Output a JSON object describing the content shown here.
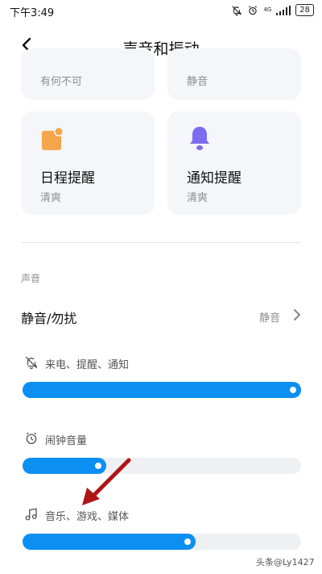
{
  "status_bar": {
    "time": "下午3:49",
    "network": "4G",
    "battery": "28"
  },
  "header": {
    "title": "声音和振动"
  },
  "cards": {
    "top_left_sub": "有何不可",
    "top_right_sub": "静音",
    "calendar_title": "日程提醒",
    "calendar_sub": "清爽",
    "notification_title": "通知提醒",
    "notification_sub": "清爽"
  },
  "sound_section": {
    "label": "声音",
    "dnd_label": "静音/勿扰",
    "dnd_value": "静音"
  },
  "volumes": [
    {
      "label": "来电、提醒、通知",
      "icon": "bell-off-icon",
      "level": 1.0
    },
    {
      "label": "闹钟音量",
      "icon": "alarm-clock-icon",
      "level": 0.3
    },
    {
      "label": "音乐、游戏、媒体",
      "icon": "music-note-icon",
      "level": 0.62
    }
  ],
  "watermark": "头条@Ly1427",
  "colors": {
    "accent": "#0c8ff2",
    "card_bg": "#f4f6f9",
    "calendar_icon": "#f6a54a",
    "bell_icon": "#7b6cf0",
    "annotation_arrow": "#b01515"
  }
}
